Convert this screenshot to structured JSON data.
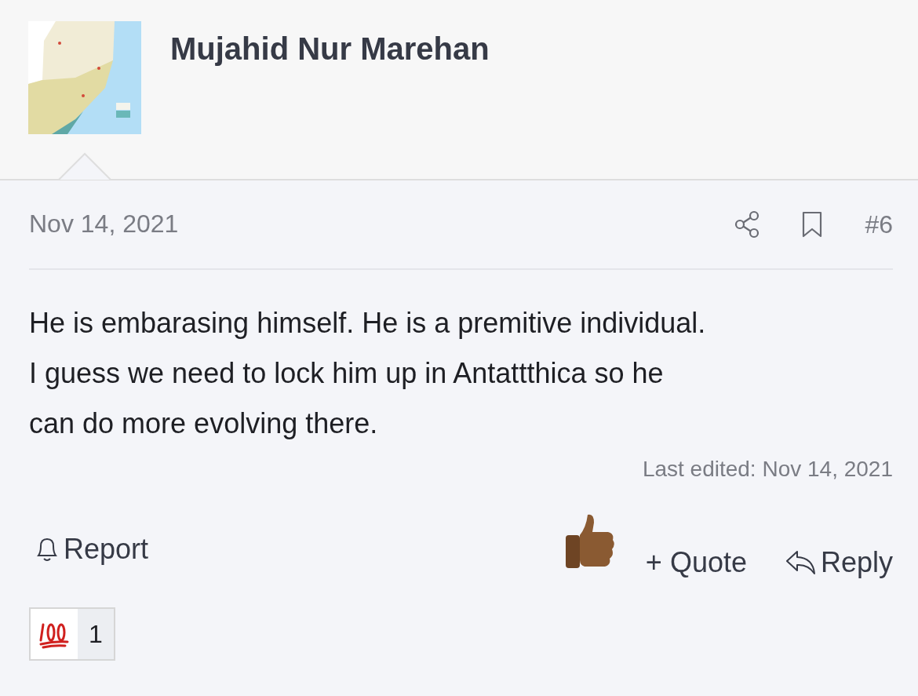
{
  "author": {
    "name": "Mujahid Nur Marehan"
  },
  "post": {
    "date": "Nov 14, 2021",
    "number": "#6",
    "body": [
      "He is embarasing himself. He is a premitive individual.",
      "I guess we need to lock him up in Antattthica so he",
      "can do more evolving there."
    ],
    "last_edited": "Last edited: Nov 14, 2021"
  },
  "actions": {
    "report": "Report",
    "quote": "Quote",
    "quote_sign": "+",
    "reply": "Reply"
  },
  "reactions": [
    {
      "count": "1"
    }
  ]
}
